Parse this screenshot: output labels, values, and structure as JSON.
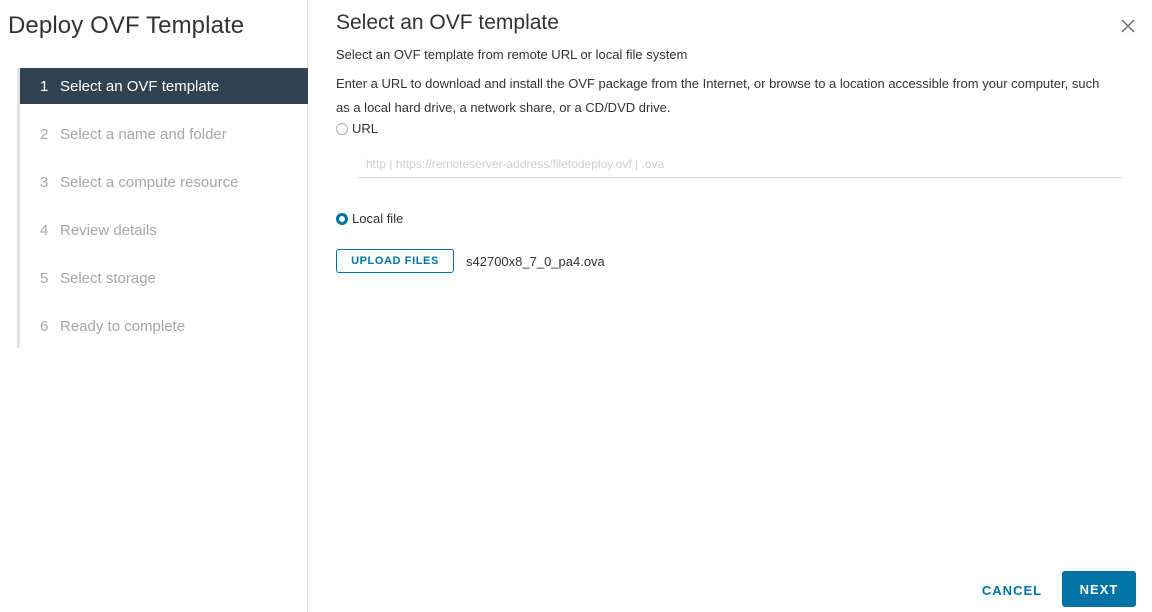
{
  "sidebar": {
    "title": "Deploy OVF Template",
    "steps": [
      {
        "num": "1",
        "label": "Select an OVF template",
        "active": true
      },
      {
        "num": "2",
        "label": "Select a name and folder",
        "active": false
      },
      {
        "num": "3",
        "label": "Select a compute resource",
        "active": false
      },
      {
        "num": "4",
        "label": "Review details",
        "active": false
      },
      {
        "num": "5",
        "label": "Select storage",
        "active": false
      },
      {
        "num": "6",
        "label": "Ready to complete",
        "active": false
      }
    ]
  },
  "main": {
    "title": "Select an OVF template",
    "subtitle": "Select an OVF template from remote URL or local file system",
    "description": "Enter a URL to download and install the OVF package from the Internet, or browse to a location accessible from your computer, such as a local hard drive, a network share, or a CD/DVD drive.",
    "url_option": {
      "label": "URL",
      "checked": false
    },
    "url_input": {
      "placeholder": "http | https://remoteserver-address/filetodeploy.ovf | .ova",
      "value": ""
    },
    "local_option": {
      "label": "Local file",
      "checked": true
    },
    "upload_label": "UPLOAD FILES",
    "file_name": "s42700x8_7_0_pa4.ova",
    "close_icon": "close-icon"
  },
  "footer": {
    "cancel_label": "CANCEL",
    "next_label": "NEXT"
  },
  "colors": {
    "accent": "#0072a3",
    "active_step_bg": "#314351",
    "disabled_text": "#a6a6a6"
  }
}
